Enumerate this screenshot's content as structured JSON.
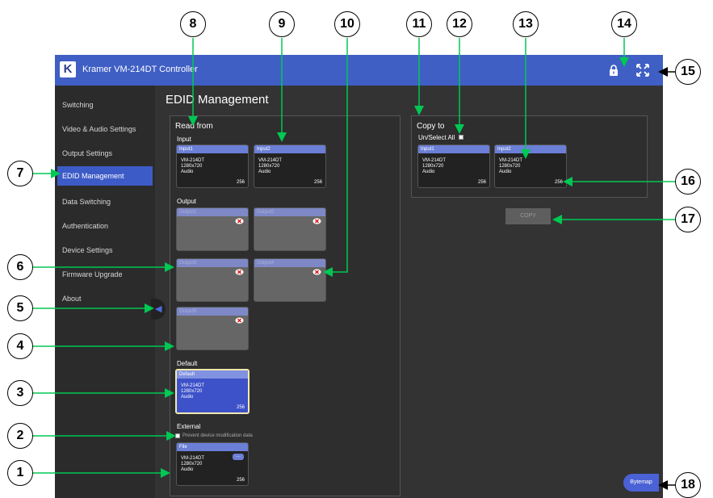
{
  "app": {
    "logo_letter": "K",
    "title": "Kramer VM-214DT Controller"
  },
  "sidebar": {
    "items": [
      {
        "label": "Switching"
      },
      {
        "label": "Video & Audio Settings"
      },
      {
        "label": "Output Settings"
      },
      {
        "label": "EDID Management",
        "active": true
      },
      {
        "label": "Data Switching"
      },
      {
        "label": "Authentication"
      },
      {
        "label": "Device Settings"
      },
      {
        "label": "Firmware Upgrade"
      },
      {
        "label": "About"
      }
    ]
  },
  "page": {
    "title": "EDID Management"
  },
  "read_from": {
    "title": "Read from",
    "input_label": "Input",
    "inputs": [
      {
        "name": "Input1",
        "l1": "VM-214DT",
        "l2": "1280x720",
        "l3": "Audio",
        "num": "256"
      },
      {
        "name": "Input2",
        "l1": "VM-214DT",
        "l2": "1280x720",
        "l3": "Audio",
        "num": "256"
      }
    ],
    "output_label": "Output",
    "outputs": [
      {
        "name": "Output1"
      },
      {
        "name": "Output2"
      },
      {
        "name": "Output3"
      },
      {
        "name": "Output4"
      },
      {
        "name": "Output5"
      }
    ],
    "default_label": "Default",
    "default_card": {
      "name": "Default",
      "l1": "VM-214DT",
      "l2": "1280x720",
      "l3": "Audio",
      "num": "256"
    },
    "external_label": "External",
    "prevent_label": "Prevent device modification data",
    "file_card": {
      "name": "File",
      "l1": "VM-214DT",
      "l2": "1280x720",
      "l3": "Audio",
      "num": "256",
      "browse": "..."
    }
  },
  "copy_to": {
    "title": "Copy to",
    "select_all_label": "Un/Select All",
    "cards": [
      {
        "name": "Input1",
        "l1": "VM-214DT",
        "l2": "1280x720",
        "l3": "Audio",
        "num": "256"
      },
      {
        "name": "Input2",
        "l1": "VM-214DT",
        "l2": "1280x720",
        "l3": "Audio",
        "num": "256"
      }
    ],
    "copy_button": "COPY"
  },
  "bytemap_button": "Bytemap",
  "callouts": [
    "1",
    "2",
    "3",
    "4",
    "5",
    "6",
    "7",
    "8",
    "9",
    "10",
    "11",
    "12",
    "13",
    "14",
    "15",
    "16",
    "17",
    "18"
  ],
  "colors": {
    "accent": "#3d5bc7",
    "arrow": "#00c853",
    "background": "#333333"
  }
}
